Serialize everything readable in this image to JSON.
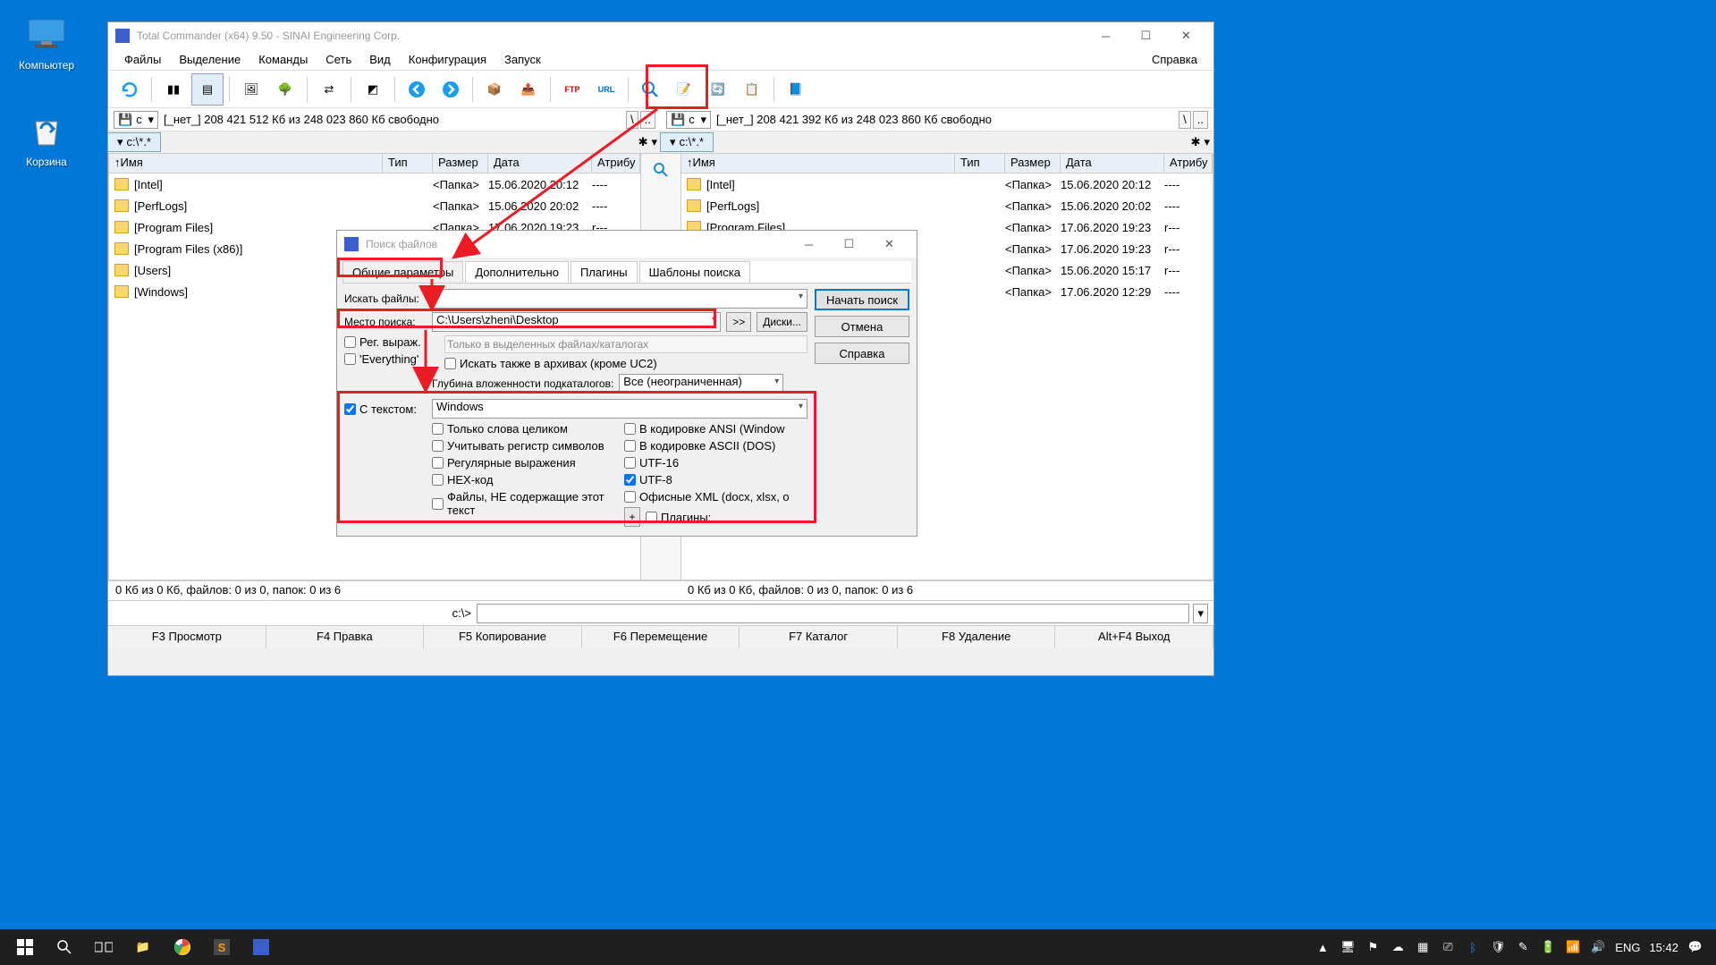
{
  "desktop": {
    "computer": "Компьютер",
    "recycle": "Корзина"
  },
  "tc": {
    "title": "Total Commander (x64) 9.50 - SINAI Engineering Corp.",
    "menu": {
      "files": "Файлы",
      "select": "Выделение",
      "commands": "Команды",
      "net": "Сеть",
      "view": "Вид",
      "config": "Конфигурация",
      "run": "Запуск",
      "help": "Справка"
    },
    "drive": {
      "letter": "c",
      "info_left": "[_нет_]  208 421 512 Кб из 248 023 860 Кб свободно",
      "info_right": "[_нет_]  208 421 392 Кб из 248 023 860 Кб свободно",
      "root": "\\",
      "up": ".."
    },
    "tab": "c:\\*.*",
    "hdr": {
      "name": "Имя",
      "ext": "Тип",
      "size": "Размер",
      "date": "Дата",
      "attr": "Атрибу"
    },
    "papka": "<Папка>",
    "rows": [
      {
        "n": "[Intel]",
        "d": "15.06.2020 20:12",
        "a": "----"
      },
      {
        "n": "[PerfLogs]",
        "d": "15.06.2020 20:02",
        "a": "----"
      },
      {
        "n": "[Program Files]",
        "d": "17.06.2020 19:23",
        "a": "r---"
      },
      {
        "n": "[Program Files (x86)]",
        "d": "17.06.2020 19:23",
        "a": "r---"
      },
      {
        "n": "[Users]",
        "d": "15.06.2020 15:17",
        "a": "r---"
      },
      {
        "n": "[Windows]",
        "d": "17.06.2020 12:29",
        "a": "----"
      }
    ],
    "status": "0 Кб из 0 Кб, файлов: 0 из 0, папок: 0 из 6",
    "cmd_prefix": "c:\\>",
    "fkeys": {
      "f3": "F3 Просмотр",
      "f4": "F4 Правка",
      "f5": "F5 Копирование",
      "f6": "F6 Перемещение",
      "f7": "F7 Каталог",
      "f8": "F8 Удаление",
      "altf4": "Alt+F4 Выход"
    }
  },
  "search": {
    "title": "Поиск файлов",
    "tabs": {
      "general": "Общие параметры",
      "adv": "Дополнительно",
      "plugins": "Плагины",
      "templates": "Шаблоны поиска"
    },
    "lbl_search": "Искать файлы:",
    "lbl_where": "Место поиска:",
    "where_val": "C:\\Users\\zheni\\Desktop",
    "btn_expand": ">>",
    "btn_drives": "Диски...",
    "chk_regex": "Рег. выраж.",
    "chk_everything": "'Everything'",
    "hint_selected": "Только в выделенных файлах/каталогах",
    "chk_archives": "Искать также в архивах (кроме UC2)",
    "lbl_depth": "Глубина вложенности подкаталогов:",
    "depth_val": "Все (неограниченная)",
    "chk_withtext": "С текстом:",
    "text_val": "Windows",
    "opts1": {
      "whole": "Только слова целиком",
      "case": "Учитывать регистр символов",
      "re": "Регулярные выражения",
      "hex": "HEX-код",
      "not": "Файлы, НЕ содержащие этот текст"
    },
    "opts2": {
      "ansi": "В кодировке ANSI (Window",
      "ascii": "В кодировке ASCII (DOS)",
      "u16": "UTF-16",
      "u8": "UTF-8",
      "oxml": "Офисные XML (docx, xlsx, о",
      "plg": "Плагины:"
    },
    "plus": "+",
    "btn_start": "Начать поиск",
    "btn_cancel": "Отмена",
    "btn_help": "Справка"
  },
  "taskbar": {
    "lang": "ENG",
    "time": "15:42"
  }
}
